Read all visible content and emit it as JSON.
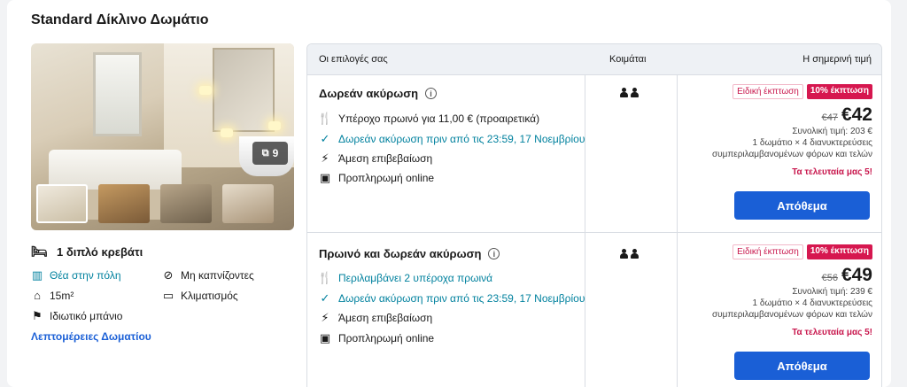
{
  "room": {
    "title": "Standard Δίκλινο Δωμάτιο",
    "photo_count": "9",
    "bed": "1 διπλό κρεβάτι",
    "amenities": [
      {
        "label": "Θέα στην πόλη",
        "icon": "city-view-icon",
        "highlight": true
      },
      {
        "label": "Μη καπνίζοντες",
        "icon": "no-smoking-icon",
        "highlight": false
      },
      {
        "label": "15m²",
        "icon": "room-size-icon",
        "highlight": false
      },
      {
        "label": "Κλιματισμός",
        "icon": "air-conditioning-icon",
        "highlight": false
      },
      {
        "label": "Ιδιωτικό μπάνιο",
        "icon": "shower-icon",
        "highlight": false
      }
    ],
    "details_link": "Λεπτομέρειες Δωματίου"
  },
  "table": {
    "headers": {
      "options": "Οι επιλογές σας",
      "sleeps": "Κοιμάται",
      "price": "Η σημερινή τιμή"
    },
    "rows": [
      {
        "title": "Δωρεάν ακύρωση",
        "features": [
          {
            "text": "Υπέροχο πρωινό για 11,00 € (προαιρετικά)",
            "icon": "utensils-icon",
            "tone": "default"
          },
          {
            "text": "Δωρεάν ακύρωση πριν από τις 23:59, 17 Νοεμβρίου",
            "icon": "check-circle-icon",
            "tone": "teal"
          },
          {
            "text": "Άμεση επιβεβαίωση",
            "icon": "lightning-icon",
            "tone": "default"
          },
          {
            "text": "Προπληρωμή online",
            "icon": "wallet-icon",
            "tone": "default"
          }
        ],
        "sale_badge": "Ειδική έκπτωση",
        "discount_badge": "10% έκπτωση",
        "old_price": "€47",
        "price": "€42",
        "total": "Συνολική τιμή: 203 €",
        "stay": "1 δωμάτιο × 4 διανυκτερεύσεις",
        "taxes": "συμπεριλαμβανομένων φόρων και τελών",
        "urgency": "Τα τελευταία μας 5!",
        "button": "Απόθεμα"
      },
      {
        "title": "Πρωινό και δωρεάν ακύρωση",
        "features": [
          {
            "text": "Περιλαμβάνει 2 υπέροχα πρωινά",
            "icon": "breakfast-icon",
            "tone": "teal"
          },
          {
            "text": "Δωρεάν ακύρωση πριν από τις 23:59, 17 Νοεμβρίου",
            "icon": "check-circle-icon",
            "tone": "teal"
          },
          {
            "text": "Άμεση επιβεβαίωση",
            "icon": "lightning-icon",
            "tone": "default"
          },
          {
            "text": "Προπληρωμή online",
            "icon": "wallet-icon",
            "tone": "default"
          }
        ],
        "sale_badge": "Ειδική έκπτωση",
        "discount_badge": "10% έκπτωση",
        "old_price": "€56",
        "price": "€49",
        "total": "Συνολική τιμή: 239 €",
        "stay": "1 δωμάτιο × 4 διανυκτερεύσεις",
        "taxes": "συμπεριλαμβανομένων φόρων και τελών",
        "urgency": "Τα τελευταία μας 5!",
        "button": "Απόθεμα"
      }
    ]
  },
  "colors": {
    "accent": "#1a5fd6",
    "sale": "#d6174f",
    "teal": "#00819e"
  }
}
